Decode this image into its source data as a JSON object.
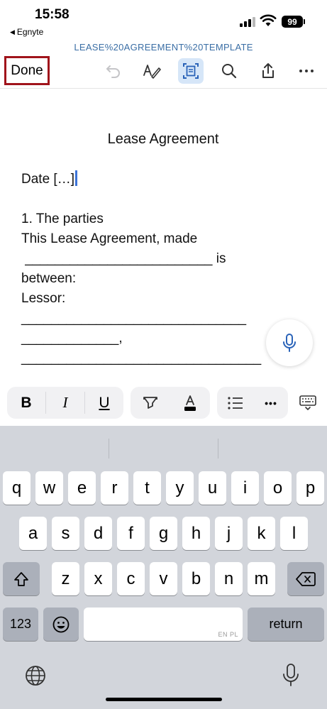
{
  "status_bar": {
    "time": "15:58",
    "back_app": "Egnyte",
    "battery": "99"
  },
  "toolbar": {
    "document_title": "LEASE%20AGREEMENT%20TEMPLATE",
    "done_label": "Done",
    "icons": [
      "undo-icon",
      "draw-icon",
      "reading-mode-icon",
      "search-icon",
      "share-icon",
      "more-icon"
    ],
    "active_icon": "reading-mode-icon",
    "accent_color": "#3a6ea5",
    "highlight_border_color": "#a0131b"
  },
  "document": {
    "heading": "Lease Agreement",
    "lines": [
      "Date […]",
      "1. The parties",
      "This Lease Agreement, made",
      " _________________________ is",
      "between:",
      "Lessor:",
      "______________________________",
      "_____________,",
      "________________________________"
    ],
    "caret_color": "#3b73d8"
  },
  "format_bar": {
    "bold": "B",
    "italic": "I",
    "underline": "U",
    "more": "•••"
  },
  "keyboard": {
    "row1": [
      "q",
      "w",
      "e",
      "r",
      "t",
      "y",
      "u",
      "i",
      "o",
      "p"
    ],
    "row2": [
      "a",
      "s",
      "d",
      "f",
      "g",
      "h",
      "j",
      "k",
      "l"
    ],
    "row3": [
      "z",
      "x",
      "c",
      "v",
      "b",
      "n",
      "m"
    ],
    "numbers_key": "123",
    "space_language": "EN PL",
    "return_key": "return"
  }
}
